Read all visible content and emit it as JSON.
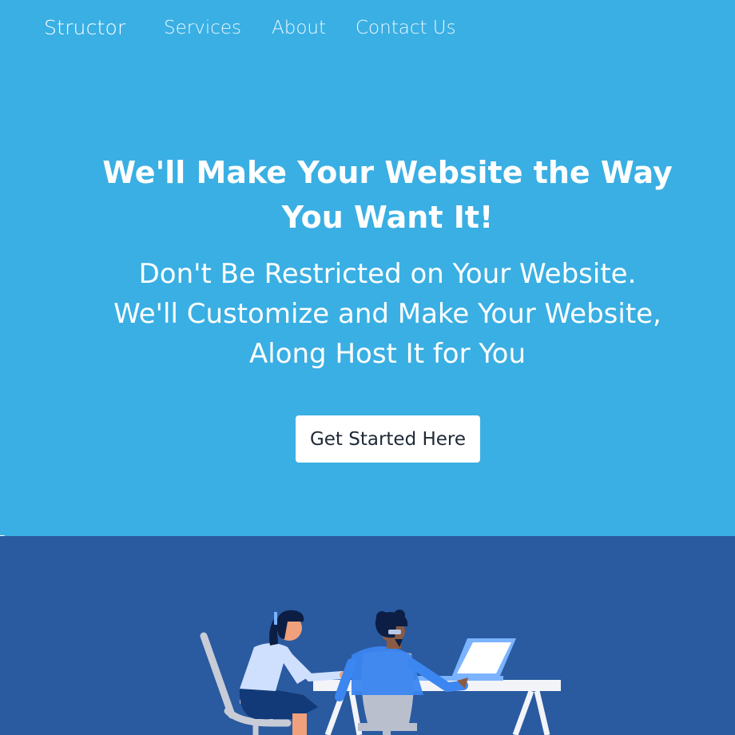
{
  "nav": {
    "brand": "Structor",
    "links": [
      "Services",
      "About",
      "Contact Us"
    ]
  },
  "hero": {
    "headline": "We'll Make Your Website the Way You Want It!",
    "subtext_lines": [
      "Don't Be Restricted on Your Website.",
      "We'll Customize and Make Your Website,",
      "Along Host It for You"
    ],
    "cta_label": "Get Started Here"
  },
  "colors": {
    "hero_background": "#3aafe3",
    "illustration_background": "#2a5aa0",
    "button_background": "#ffffff",
    "text_light": "#ffffff"
  },
  "illustration": {
    "subject": "two people working at a desk with a laptop",
    "icon_names": [
      "office-chair-icon",
      "desk-icon",
      "laptop-icon",
      "person-woman-icon",
      "person-man-icon"
    ]
  }
}
